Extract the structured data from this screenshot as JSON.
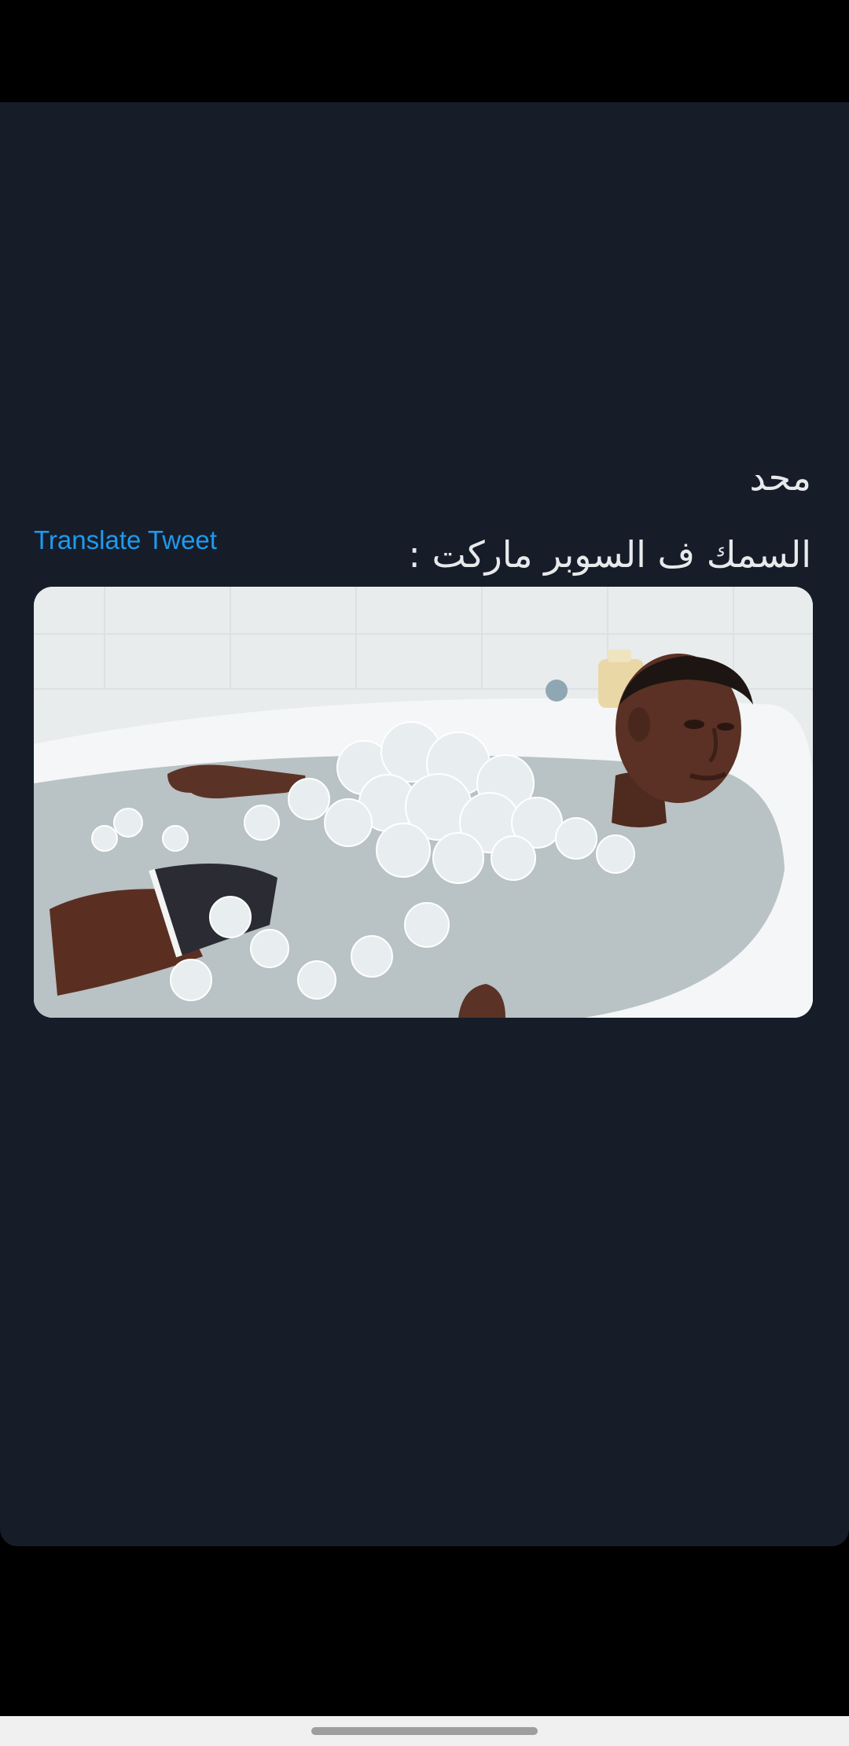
{
  "tweet": {
    "text_lines": [
      "محد",
      "السمك ف السوبر ماركت :"
    ],
    "translate_label": "Translate Tweet",
    "media_icon": "photo-man-in-ice-bathtub"
  },
  "colors": {
    "background": "#000000",
    "card": "#161d29",
    "text": "#e7e9ea",
    "link": "#1d9bf0",
    "nav_bar": "#f0f0f0"
  }
}
